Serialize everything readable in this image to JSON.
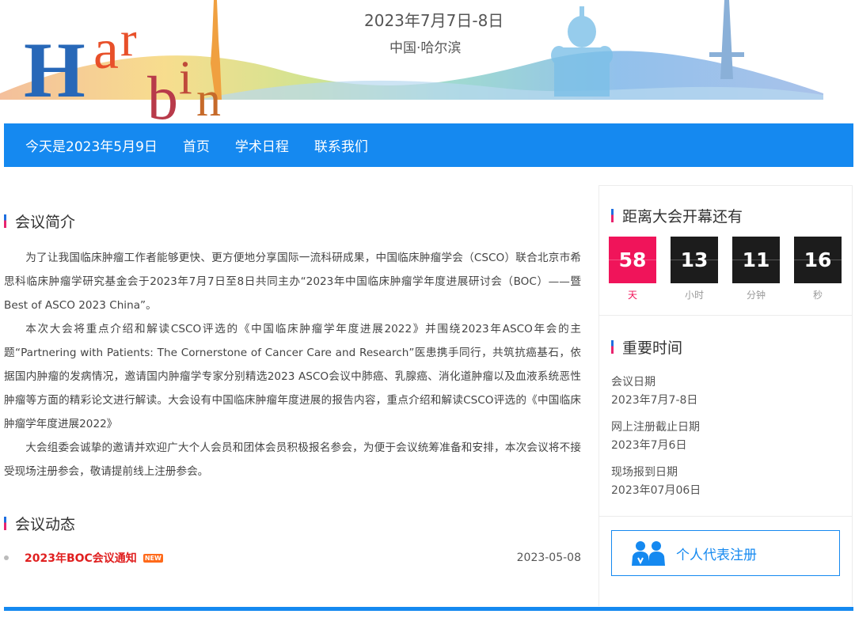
{
  "banner": {
    "logo_text": "Harbin",
    "date": "2023年7月7日-8日",
    "city": "中国·哈尔滨"
  },
  "nav": {
    "today": "今天是2023年5月9日",
    "items": [
      "首页",
      "学术日程",
      "联系我们"
    ]
  },
  "intro": {
    "heading": "会议简介",
    "paragraphs": [
      "为了让我国临床肿瘤工作者能够更快、更方便地分享国际一流科研成果，中国临床肿瘤学会（CSCO）联合北京市希思科临床肿瘤学研究基金会于2023年7月7日至8日共同主办“2023年中国临床肿瘤学年度进展研讨会（BOC）——暨Best of ASCO 2023 China”。",
      "本次大会将重点介绍和解读CSCO评选的《中国临床肿瘤学年度进展2022》并围绕2023年ASCO年会的主题“Partnering with Patients: The Cornerstone of Cancer Care and Research”医患携手同行，共筑抗癌基石，依据国内肿瘤的发病情况，邀请国内肿瘤学专家分别精选2023 ASCO会议中肺癌、乳腺癌、消化道肿瘤以及血液系统恶性肿瘤等方面的精彩论文进行解读。大会设有中国临床肿瘤年度进展的报告内容，重点介绍和解读CSCO评选的《中国临床肿瘤学年度进展2022》",
      "大会组委会诚挚的邀请并欢迎广大个人会员和团体会员积极报名参会，为便于会议统筹准备和安排，本次会议将不接受现场注册参会，敬请提前线上注册参会。"
    ]
  },
  "news": {
    "heading": "会议动态",
    "items": [
      {
        "title": "2023年BOC会议通知",
        "badge": "NEW",
        "date": "2023-05-08"
      }
    ]
  },
  "countdown": {
    "heading": "距离大会开幕还有",
    "days": "58",
    "days_label": "天",
    "hours": "13",
    "hours_label": "小时",
    "minutes": "11",
    "minutes_label": "分钟",
    "seconds": "16",
    "seconds_label": "秒"
  },
  "key_dates": {
    "heading": "重要时间",
    "items": [
      {
        "label": "会议日期",
        "value": "2023年7月7-8日"
      },
      {
        "label": "网上注册截止日期",
        "value": "2023年7月6日"
      },
      {
        "label": "现场报到日期",
        "value": "2023年07月06日"
      }
    ]
  },
  "register": {
    "label": "个人代表注册"
  },
  "colors": {
    "nav_blue": "#1589f0",
    "countdown_red": "#f0145a",
    "countdown_dark": "#1c1c1c",
    "news_red": "#e02020"
  }
}
